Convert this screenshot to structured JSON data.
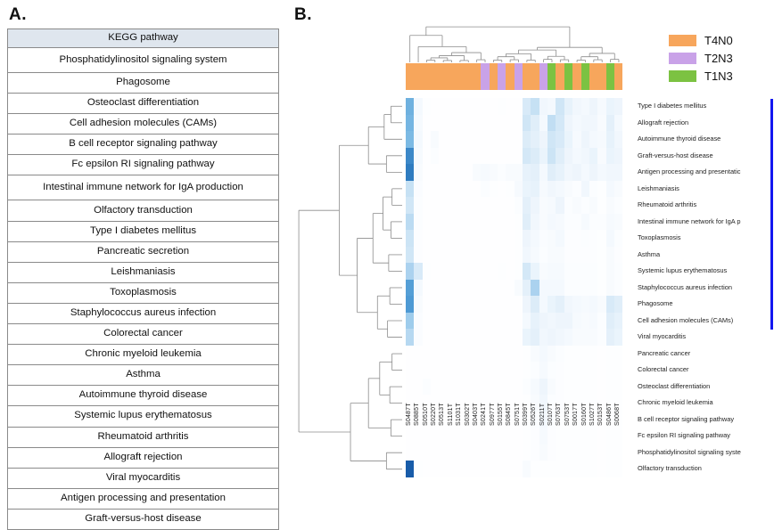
{
  "panels": {
    "a_label": "A.",
    "b_label": "B."
  },
  "panel_a": {
    "header": "KEGG pathway",
    "pathways": [
      "Phosphatidylinositol signaling system",
      "Phagosome",
      "Osteoclast differentiation",
      "Cell adhesion molecules (CAMs)",
      "B cell receptor signaling pathway",
      "Fc epsilon RI signaling pathway",
      "Intestinal immune network for IgA production",
      "Olfactory transduction",
      "Type I diabetes mellitus",
      "Pancreatic secretion",
      "Leishmaniasis",
      "Toxoplasmosis",
      "Staphylococcus aureus infection",
      "Colorectal cancer",
      "Chronic myeloid leukemia",
      "Asthma",
      "Autoimmune thyroid disease",
      "Systemic lupus erythematosus",
      "Rheumatoid arthritis",
      "Allograft rejection",
      "Viral myocarditis",
      "Antigen processing and presentation",
      "Graft-versus-host disease"
    ]
  },
  "legend": {
    "items": [
      {
        "label": "T4N0",
        "color": "#f7a65c"
      },
      {
        "label": "T2N3",
        "color": "#c9a2e8"
      },
      {
        "label": "T1N3",
        "color": "#7cc martin"
      }
    ]
  },
  "chart_data": {
    "type": "heatmap",
    "title": "",
    "xlabel": "",
    "ylabel": "",
    "colormap": {
      "low": "#ffffff",
      "high": "#08519c",
      "name": "white-to-blue"
    },
    "value_range": [
      0,
      1
    ],
    "grid": false,
    "legend_position": "top-right",
    "row_labels": [
      "Type I diabetes mellitus",
      "Allograft rejection",
      "Autoimmune thyroid disease",
      "Graft-versus-host disease",
      "Antigen processing and presentatic",
      "Leishmaniasis",
      "Rheumatoid arthritis",
      "Intestinal immune network for IgA p",
      "Toxoplasmosis",
      "Asthma",
      "Systemic lupus erythematosus",
      "Staphylococcus aureus infection",
      "Phagosome",
      "Cell adhesion molecules (CAMs)",
      "Viral myocarditis",
      "Pancreatic cancer",
      "Colorectal cancer",
      "Osteoclast differentiation",
      "Chronic myeloid leukemia",
      "B cell receptor signaling pathway",
      "Fc epsilon RI signaling pathway",
      "Phosphatidylinositol signaling syste",
      "Olfactory transduction"
    ],
    "column_labels": [
      "S0487T",
      "S0885T",
      "S0510T",
      "S0220T",
      "S0513T",
      "S1101T",
      "S1031T",
      "S0302T",
      "S0403T",
      "S0241T",
      "S0977T",
      "S0155T",
      "S0845T",
      "S0751T",
      "S0399T",
      "S0526T",
      "S0211T",
      "S0107T",
      "S0763T",
      "S0753T",
      "S0017T",
      "S0160T",
      "S1027T",
      "S0153T",
      "S0486T",
      "S0068T"
    ],
    "column_groups": [
      "T4N0",
      "T4N0",
      "T4N0",
      "T4N0",
      "T4N0",
      "T4N0",
      "T4N0",
      "T4N0",
      "T4N0",
      "T2N3",
      "T4N0",
      "T2N3",
      "T4N0",
      "T2N3",
      "T4N0",
      "T4N0",
      "T2N3",
      "T1N3",
      "T4N0",
      "T1N3",
      "T4N0",
      "T1N3",
      "T4N0",
      "T4N0",
      "T1N3",
      "T4N0"
    ],
    "values": [
      [
        0.62,
        0.1,
        0.02,
        0.01,
        0.01,
        0.01,
        0.01,
        0.01,
        0.01,
        0.01,
        0.01,
        0.02,
        0.01,
        0.01,
        0.26,
        0.34,
        0.12,
        0.1,
        0.3,
        0.18,
        0.12,
        0.1,
        0.14,
        0.08,
        0.16,
        0.14
      ],
      [
        0.6,
        0.08,
        0.01,
        0.01,
        0.01,
        0.01,
        0.01,
        0.01,
        0.01,
        0.01,
        0.01,
        0.01,
        0.01,
        0.01,
        0.3,
        0.22,
        0.1,
        0.36,
        0.28,
        0.14,
        0.1,
        0.12,
        0.12,
        0.06,
        0.2,
        0.1
      ],
      [
        0.58,
        0.1,
        0.01,
        0.06,
        0.01,
        0.01,
        0.01,
        0.01,
        0.01,
        0.01,
        0.01,
        0.01,
        0.01,
        0.01,
        0.24,
        0.2,
        0.14,
        0.3,
        0.26,
        0.16,
        0.08,
        0.14,
        0.1,
        0.08,
        0.18,
        0.12
      ],
      [
        0.78,
        0.08,
        0.01,
        0.04,
        0.01,
        0.01,
        0.01,
        0.01,
        0.01,
        0.01,
        0.01,
        0.01,
        0.01,
        0.01,
        0.28,
        0.24,
        0.16,
        0.32,
        0.22,
        0.14,
        0.1,
        0.12,
        0.16,
        0.06,
        0.16,
        0.14
      ],
      [
        0.82,
        0.06,
        0.01,
        0.01,
        0.01,
        0.01,
        0.01,
        0.01,
        0.06,
        0.08,
        0.06,
        0.04,
        0.06,
        0.06,
        0.18,
        0.2,
        0.1,
        0.22,
        0.18,
        0.12,
        0.14,
        0.1,
        0.14,
        0.1,
        0.12,
        0.12
      ],
      [
        0.34,
        0.05,
        0.01,
        0.01,
        0.01,
        0.01,
        0.01,
        0.01,
        0.01,
        0.04,
        0.02,
        0.01,
        0.02,
        0.08,
        0.16,
        0.18,
        0.08,
        0.12,
        0.1,
        0.06,
        0.04,
        0.12,
        0.04,
        0.02,
        0.1,
        0.06
      ],
      [
        0.3,
        0.04,
        0.01,
        0.01,
        0.01,
        0.01,
        0.01,
        0.01,
        0.01,
        0.01,
        0.01,
        0.01,
        0.01,
        0.04,
        0.2,
        0.14,
        0.06,
        0.08,
        0.14,
        0.04,
        0.06,
        0.04,
        0.06,
        0.02,
        0.06,
        0.04
      ],
      [
        0.38,
        0.04,
        0.01,
        0.01,
        0.01,
        0.01,
        0.01,
        0.01,
        0.01,
        0.01,
        0.01,
        0.01,
        0.01,
        0.02,
        0.22,
        0.12,
        0.06,
        0.1,
        0.08,
        0.04,
        0.04,
        0.08,
        0.04,
        0.04,
        0.08,
        0.06
      ],
      [
        0.32,
        0.03,
        0.01,
        0.01,
        0.01,
        0.01,
        0.01,
        0.01,
        0.01,
        0.01,
        0.01,
        0.01,
        0.01,
        0.02,
        0.14,
        0.1,
        0.05,
        0.06,
        0.1,
        0.03,
        0.03,
        0.04,
        0.03,
        0.02,
        0.1,
        0.04
      ],
      [
        0.3,
        0.03,
        0.01,
        0.01,
        0.01,
        0.01,
        0.01,
        0.01,
        0.01,
        0.01,
        0.01,
        0.01,
        0.01,
        0.02,
        0.12,
        0.08,
        0.04,
        0.06,
        0.06,
        0.03,
        0.03,
        0.03,
        0.03,
        0.02,
        0.06,
        0.03
      ],
      [
        0.44,
        0.26,
        0.02,
        0.01,
        0.01,
        0.01,
        0.01,
        0.01,
        0.01,
        0.01,
        0.01,
        0.02,
        0.01,
        0.02,
        0.28,
        0.16,
        0.06,
        0.08,
        0.08,
        0.04,
        0.04,
        0.04,
        0.04,
        0.02,
        0.06,
        0.04
      ],
      [
        0.7,
        0.1,
        0.01,
        0.01,
        0.01,
        0.01,
        0.01,
        0.01,
        0.01,
        0.01,
        0.01,
        0.01,
        0.01,
        0.06,
        0.2,
        0.44,
        0.1,
        0.1,
        0.1,
        0.04,
        0.04,
        0.04,
        0.04,
        0.02,
        0.06,
        0.04
      ],
      [
        0.72,
        0.06,
        0.01,
        0.01,
        0.01,
        0.01,
        0.01,
        0.01,
        0.01,
        0.01,
        0.01,
        0.01,
        0.01,
        0.01,
        0.14,
        0.24,
        0.1,
        0.16,
        0.2,
        0.12,
        0.1,
        0.08,
        0.1,
        0.06,
        0.26,
        0.22
      ],
      [
        0.48,
        0.05,
        0.01,
        0.01,
        0.01,
        0.01,
        0.01,
        0.01,
        0.01,
        0.01,
        0.01,
        0.01,
        0.01,
        0.01,
        0.1,
        0.18,
        0.14,
        0.12,
        0.14,
        0.14,
        0.08,
        0.06,
        0.08,
        0.04,
        0.22,
        0.18
      ],
      [
        0.4,
        0.05,
        0.01,
        0.01,
        0.01,
        0.01,
        0.01,
        0.01,
        0.01,
        0.01,
        0.01,
        0.01,
        0.01,
        0.01,
        0.16,
        0.2,
        0.12,
        0.14,
        0.12,
        0.1,
        0.06,
        0.06,
        0.06,
        0.04,
        0.2,
        0.16
      ],
      [
        0.01,
        0.01,
        0.01,
        0.01,
        0.01,
        0.01,
        0.01,
        0.01,
        0.01,
        0.01,
        0.01,
        0.01,
        0.01,
        0.01,
        0.02,
        0.06,
        0.1,
        0.06,
        0.04,
        0.02,
        0.02,
        0.02,
        0.02,
        0.01,
        0.02,
        0.02
      ],
      [
        0.01,
        0.01,
        0.01,
        0.01,
        0.01,
        0.01,
        0.01,
        0.01,
        0.01,
        0.01,
        0.01,
        0.01,
        0.01,
        0.01,
        0.02,
        0.04,
        0.08,
        0.04,
        0.03,
        0.02,
        0.02,
        0.02,
        0.02,
        0.01,
        0.02,
        0.02
      ],
      [
        0.01,
        0.01,
        0.04,
        0.01,
        0.01,
        0.01,
        0.01,
        0.01,
        0.01,
        0.01,
        0.01,
        0.01,
        0.01,
        0.01,
        0.04,
        0.08,
        0.14,
        0.06,
        0.03,
        0.02,
        0.02,
        0.02,
        0.02,
        0.01,
        0.02,
        0.02
      ],
      [
        0.01,
        0.01,
        0.01,
        0.01,
        0.01,
        0.01,
        0.01,
        0.01,
        0.01,
        0.01,
        0.01,
        0.01,
        0.01,
        0.01,
        0.02,
        0.06,
        0.12,
        0.04,
        0.03,
        0.02,
        0.02,
        0.02,
        0.02,
        0.01,
        0.02,
        0.02
      ],
      [
        0.01,
        0.01,
        0.01,
        0.01,
        0.01,
        0.01,
        0.01,
        0.01,
        0.01,
        0.01,
        0.01,
        0.01,
        0.01,
        0.01,
        0.02,
        0.04,
        0.1,
        0.04,
        0.02,
        0.02,
        0.02,
        0.02,
        0.02,
        0.01,
        0.02,
        0.02
      ],
      [
        0.01,
        0.01,
        0.01,
        0.01,
        0.01,
        0.01,
        0.01,
        0.01,
        0.01,
        0.01,
        0.01,
        0.01,
        0.01,
        0.01,
        0.02,
        0.03,
        0.08,
        0.03,
        0.02,
        0.02,
        0.02,
        0.02,
        0.02,
        0.01,
        0.02,
        0.02
      ],
      [
        0.01,
        0.01,
        0.01,
        0.01,
        0.01,
        0.01,
        0.01,
        0.01,
        0.01,
        0.01,
        0.01,
        0.01,
        0.01,
        0.01,
        0.02,
        0.03,
        0.06,
        0.03,
        0.02,
        0.02,
        0.02,
        0.02,
        0.02,
        0.01,
        0.02,
        0.02
      ],
      [
        0.92,
        0.02,
        0.01,
        0.01,
        0.01,
        0.01,
        0.01,
        0.01,
        0.01,
        0.01,
        0.01,
        0.01,
        0.01,
        0.01,
        0.06,
        0.02,
        0.02,
        0.02,
        0.02,
        0.02,
        0.02,
        0.02,
        0.02,
        0.01,
        0.02,
        0.02
      ]
    ]
  }
}
